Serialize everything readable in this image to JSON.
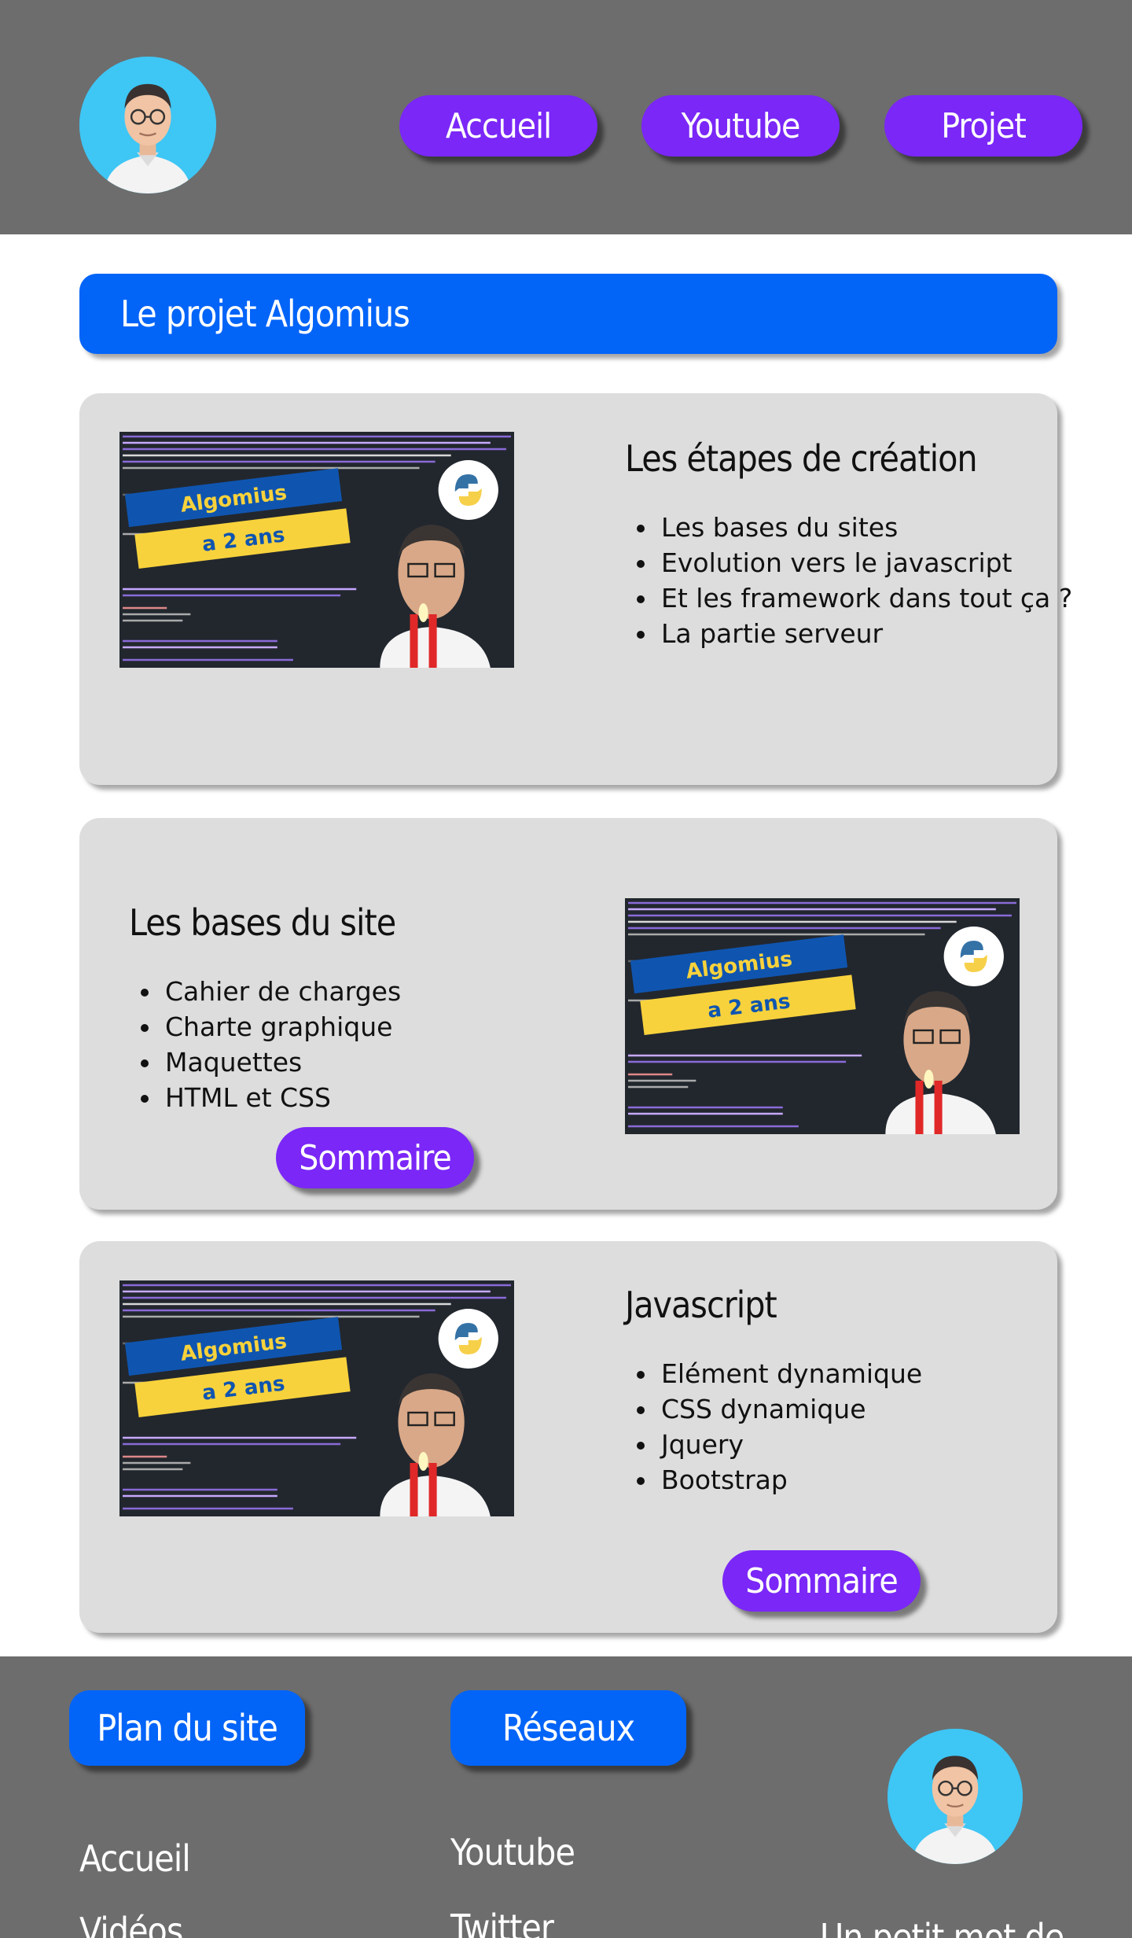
{
  "header": {
    "nav": [
      {
        "label": "Accueil"
      },
      {
        "label": "Youtube"
      },
      {
        "label": "Projet"
      }
    ]
  },
  "main": {
    "title": "Le projet Algomius",
    "thumbnail": {
      "line1": "Algomius",
      "line2": "a 2 ans"
    },
    "cards": [
      {
        "title": "Les étapes de création",
        "items": [
          "Les bases du sites",
          "Evolution vers le javascript",
          "Et les framework dans tout ça ?",
          "La partie serveur"
        ]
      },
      {
        "title": "Les bases du site",
        "items": [
          "Cahier de charges",
          "Charte graphique",
          "Maquettes",
          "HTML et CSS"
        ],
        "button": "Sommaire"
      },
      {
        "title": "Javascript",
        "items": [
          "Elément dynamique",
          "CSS dynamique",
          "Jquery",
          "Bootstrap"
        ],
        "button": "Sommaire"
      }
    ]
  },
  "footer": {
    "sitemap_label": "Plan du site",
    "social_label": "Réseaux",
    "sitemap_links": [
      "Accueil",
      "Vidéos"
    ],
    "social_links": [
      "Youtube",
      "Twitter"
    ],
    "partial_text": "Un petit mot de"
  },
  "colors": {
    "header_bg": "#6d6d6d",
    "nav_button": "#7a27f7",
    "title_bar": "#0364f8",
    "card_bg": "#dddddd",
    "avatar_bg": "#3ec6f5"
  }
}
